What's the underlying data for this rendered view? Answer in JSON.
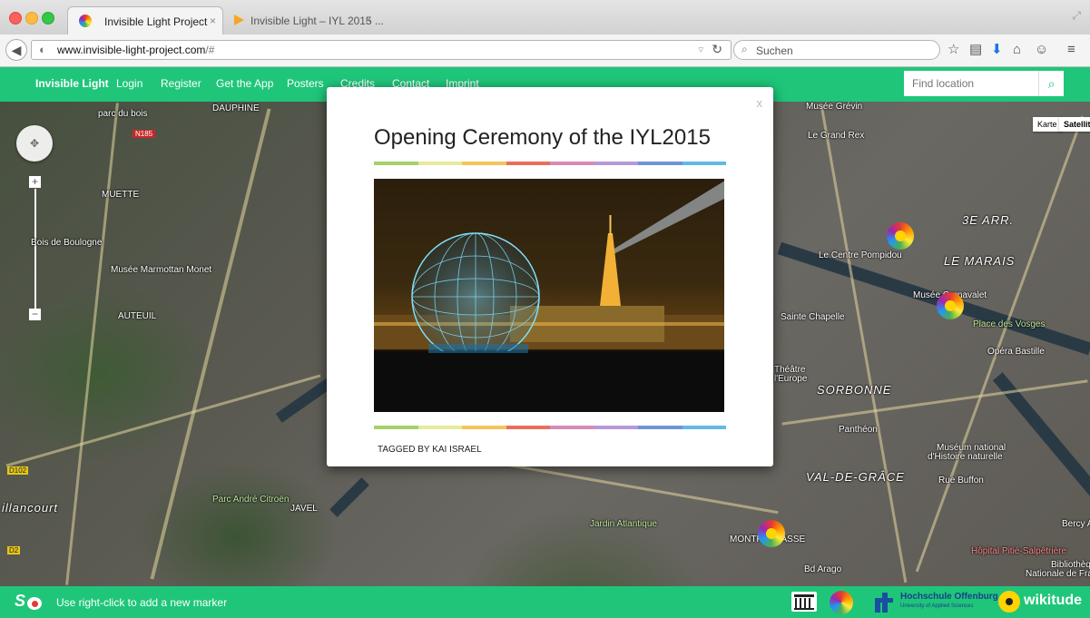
{
  "browser": {
    "tabs": [
      {
        "label": "Invisible Light Project",
        "close": "×",
        "active": true
      },
      {
        "label": "Invisible Light – IYL 2015 ...",
        "close": "×",
        "active": false
      }
    ],
    "url": {
      "host": "www.invisible-light-project.com",
      "path": "/#"
    },
    "search_placeholder": "Suchen"
  },
  "site_nav": {
    "items": [
      "Invisible Light",
      "Login",
      "Register",
      "Get the App",
      "Posters",
      "Credits",
      "Contact",
      "Imprint"
    ],
    "find_placeholder": "Find location"
  },
  "map": {
    "type_buttons": [
      "Karte",
      "Satellit"
    ],
    "labels": {
      "parc_du_bois": "parc du bois",
      "muette": "MUETTE",
      "bois_de_boulogne": "Bois de Boulogne",
      "marmottan": "Musée Marmottan Monet",
      "auteuil": "AUTEUIL",
      "billancourt": "illancourt",
      "parc_citroen": "Parc André Citroën",
      "javel": "JAVEL",
      "dauphine": "DAUPHINE",
      "n185": "N185",
      "d102": "D102",
      "d2": "D2",
      "musee_grevin": "Musée Grévin",
      "le_grand_rex": "Le Grand Rex",
      "pompidou": "Le Centre Pompidou",
      "le_marais": "LE MARAIS",
      "third_arr": "3E ARR.",
      "carnavalet": "Musée Carnavalet",
      "vosges": "Place des Vosges",
      "sainte_chapelle": "Sainte Chapelle",
      "opera_bastille": "Opéra Bastille",
      "theatre": "Théâtre",
      "europe": "l'Europe",
      "sorbonne": "SORBONNE",
      "pantheon": "Panthéon",
      "museum": "Muséum national",
      "museum2": "d'Histoire naturelle",
      "val_de_grace": "VAL-DE-GRÂCE",
      "rue_buffon": "Rue Buffon",
      "montparnasse": "MONTPARNASSE",
      "bd_arago": "Bd Arago",
      "jardin_atlantique": "Jardin Atlantique",
      "pitie": "Hôpital Pitié-Salpêtrière",
      "bibliotheque": "Bibliothèq",
      "nationale": "Nationale de Fran",
      "bercy": "Bercy Ar"
    }
  },
  "modal": {
    "close": "x",
    "title": "Opening Ceremony of the IYL2015",
    "tagged_by": "TAGGED BY KAI ISRAEL",
    "rainbow_colors": [
      "#a6d06a",
      "#e7ea9a",
      "#f3c45a",
      "#ea6f5a",
      "#d88ab4",
      "#b59ad6",
      "#6f93d8",
      "#62b9e3"
    ]
  },
  "footer": {
    "hint": "Use right-click to add a new marker",
    "partner_1": "Hochschule Offenburg",
    "partner_1_sub": "University of Applied Sciences",
    "partner_2": "wikitude"
  },
  "colors": {
    "brand": "#1fc67a"
  }
}
